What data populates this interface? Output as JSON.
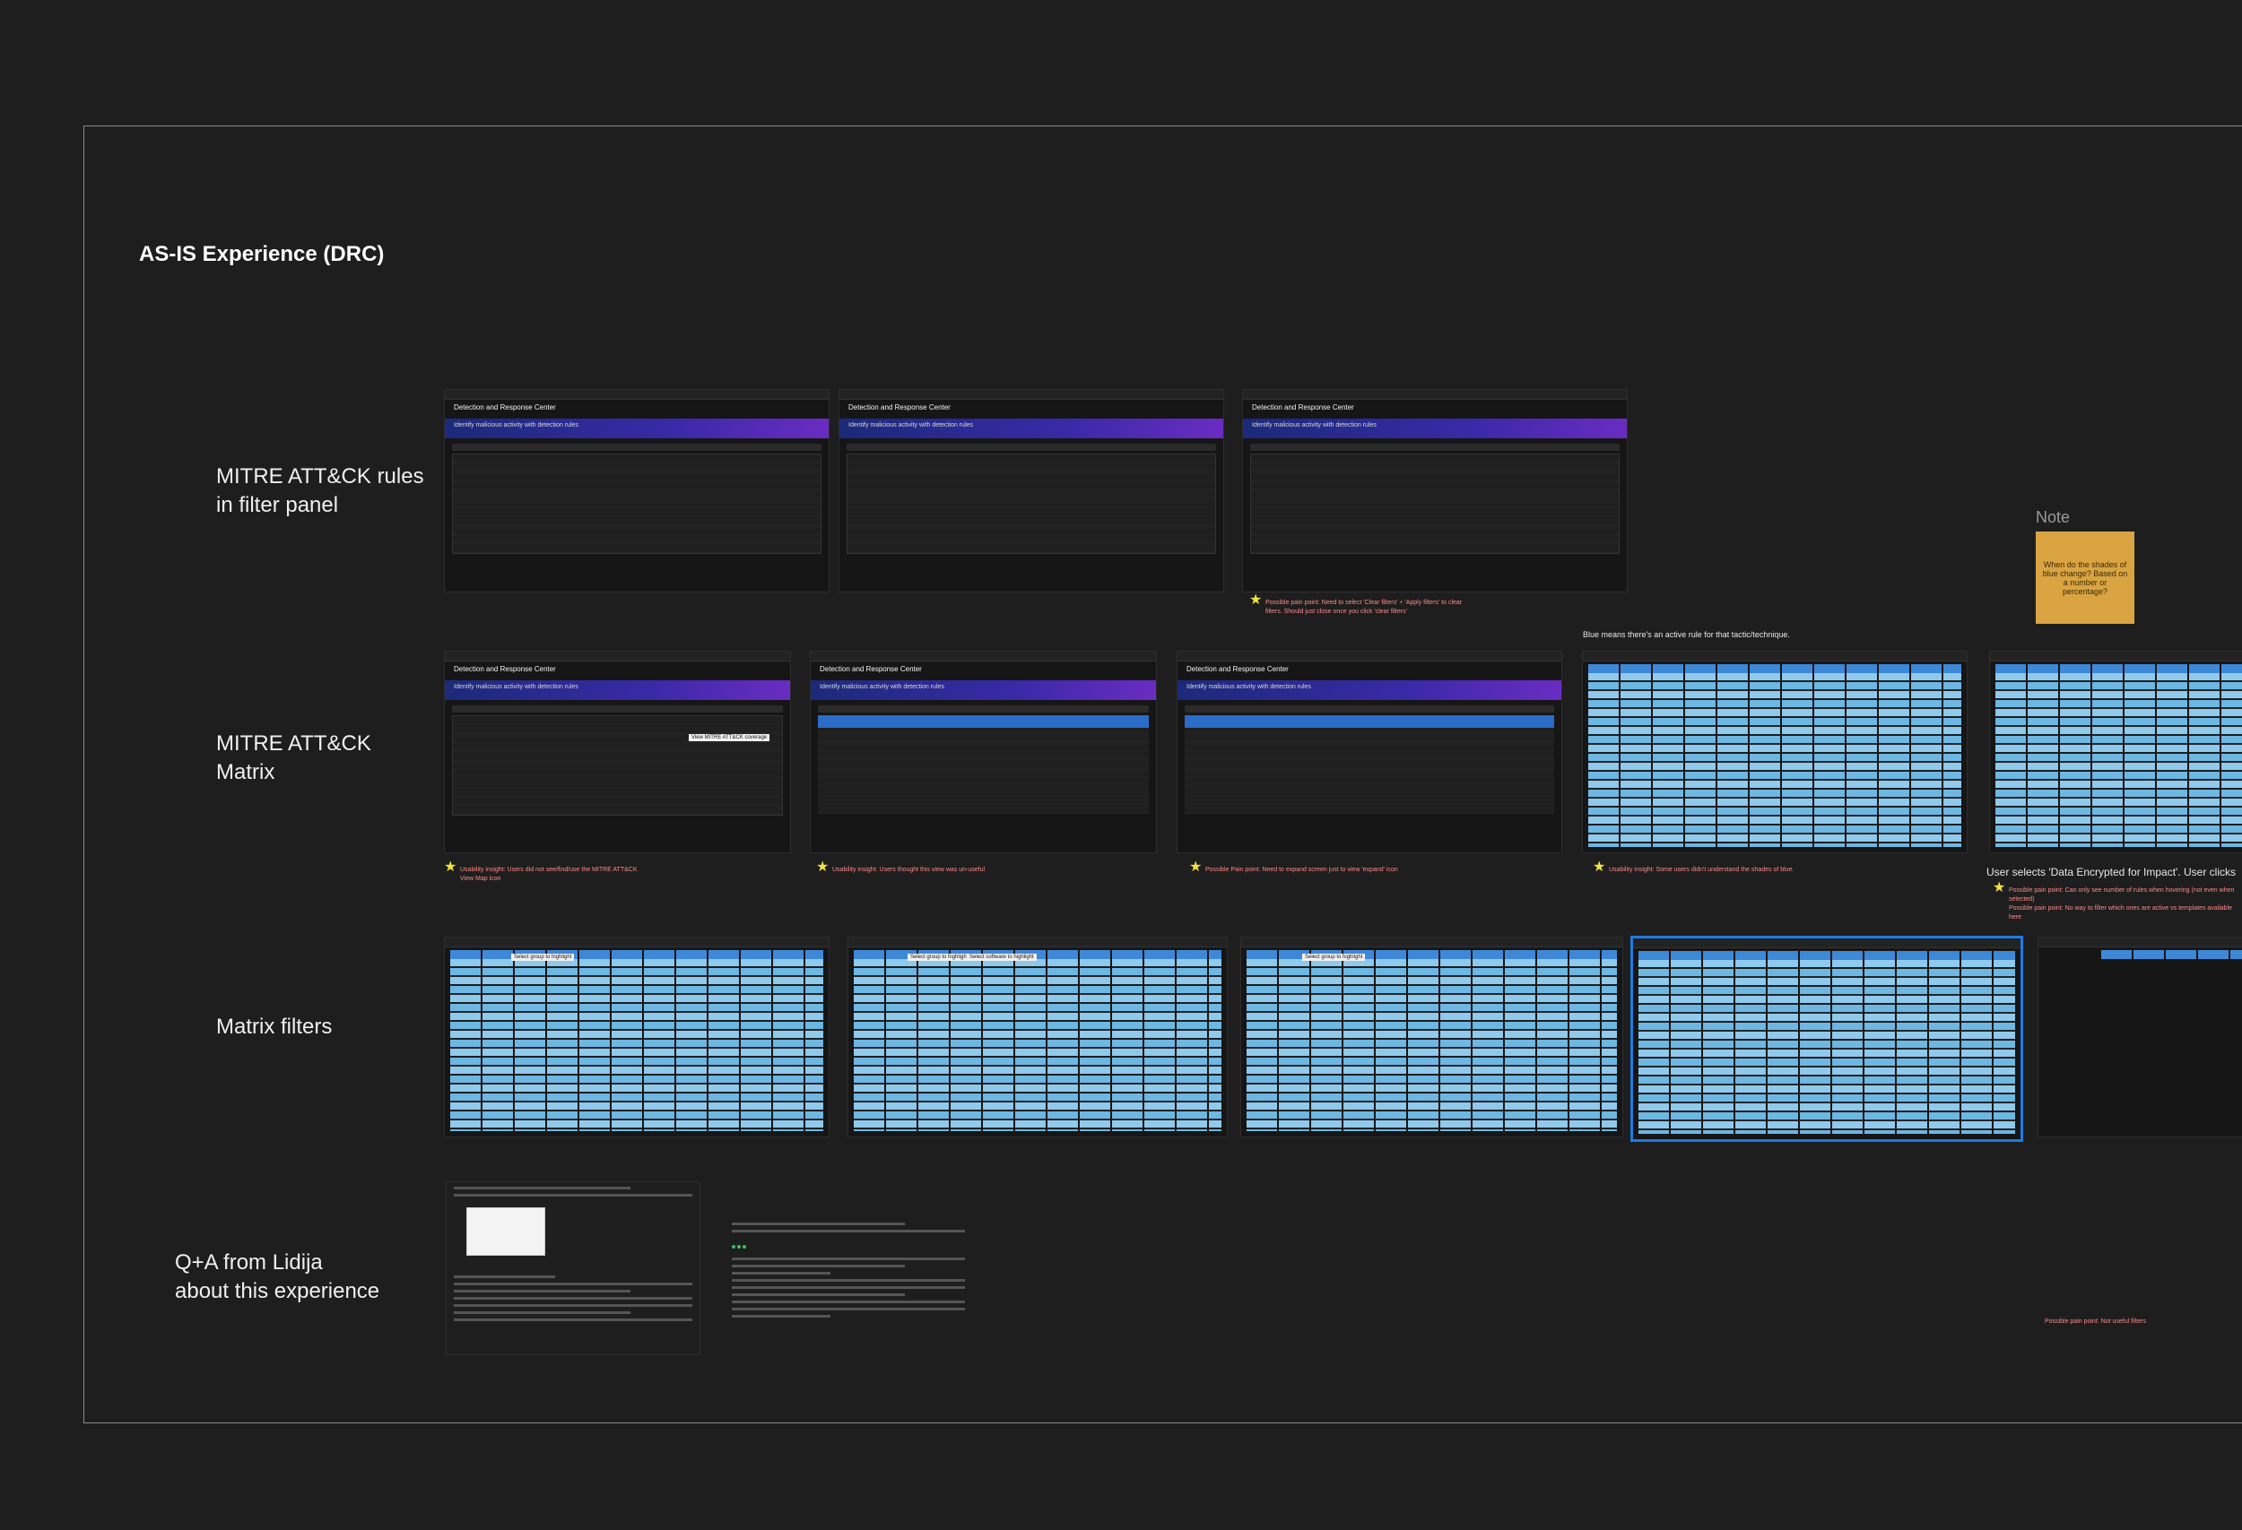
{
  "board": {
    "title": "AS-IS Experience (DRC)"
  },
  "rows": [
    {
      "label": "MITRE ATT&CK rules\nin filter panel"
    },
    {
      "label": "MITRE ATT&CK\nMatrix"
    },
    {
      "label": "Matrix filters"
    },
    {
      "label": "Q+A from Lidija\nabout this experience"
    }
  ],
  "screens": {
    "app_title": "Detection and Response Center",
    "banner_text": "Identify malicious activity with detection rules"
  },
  "notes": {
    "row1_pain": "Possible pain point: Need to select 'Clear filters' + 'Apply filters' to clear filters. Should just close once you click 'clear filters'",
    "row2_note1": "Usability insight: Users did not see/find/use the MITRE ATT&CK View Map icon",
    "row2_note2": "Usability insight: Users thought this view was un-useful",
    "row2_note3": "Possible Pain point: Need to expand screen just to view 'expand' icon",
    "row2_note4": "Usability insight: Some users didn't understand the shades of blue.",
    "row2_caption": "Blue means there's an active rule for that tactic/technique.",
    "row2_user_selects": "User selects 'Data Encrypted for Impact'. User clicks",
    "row2_pain_a": "Possible pain point: Can only see number of rules when hovering (not even when selected)",
    "row2_pain_b": "Possible pain point: No way to filter which ones are active vs templates available here",
    "row3_pain": "Possible pain point: Not useful filters",
    "tooltip_view_map": "View MITRE ATT&CK coverage",
    "popup_select_group": "Select group to highlight",
    "popup_select_software": "Select software to highlight"
  },
  "sticky": {
    "label": "Note",
    "text": "When do the shades of blue change? Based on a number or percentage?"
  }
}
